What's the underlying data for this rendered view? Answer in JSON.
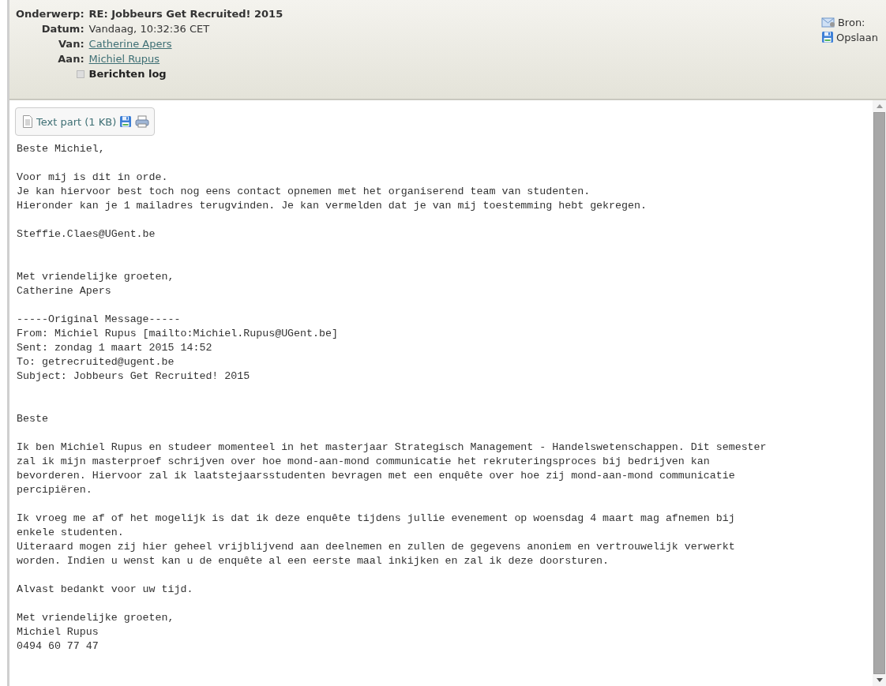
{
  "header": {
    "fields": [
      {
        "label": "Onderwerp:",
        "value": "RE: Jobbeurs Get Recruited! 2015",
        "kind": "subject"
      },
      {
        "label": "Datum:",
        "value": "Vandaag, 10:32:36 CET",
        "kind": "text"
      },
      {
        "label": "Van:",
        "value": "Catherine Apers",
        "kind": "link"
      },
      {
        "label": "Aan:",
        "value": "Michiel Rupus",
        "kind": "link"
      }
    ],
    "log": {
      "label": "Berichten log",
      "expanded": false
    },
    "actions": [
      {
        "label": "Bron:",
        "kind": "source"
      },
      {
        "label": "Opslaan",
        "kind": "save"
      }
    ]
  },
  "attachment": {
    "label": "Text part (1 KB)"
  },
  "body": "Beste Michiel,\n\nVoor mij is dit in orde.\nJe kan hiervoor best toch nog eens contact opnemen met het organiserend team van studenten.\nHieronder kan je 1 mailadres terugvinden. Je kan vermelden dat je van mij toestemming hebt gekregen.\n\nSteffie.Claes@UGent.be\n\n\nMet vriendelijke groeten,\nCatherine Apers\n\n-----Original Message-----\nFrom: Michiel Rupus [mailto:Michiel.Rupus@UGent.be]\nSent: zondag 1 maart 2015 14:52\nTo: getrecruited@ugent.be\nSubject: Jobbeurs Get Recruited! 2015\n\n\nBeste\n\nIk ben Michiel Rupus en studeer momenteel in het masterjaar Strategisch Management - Handelswetenschappen. Dit semester\nzal ik mijn masterproef schrijven over hoe mond-aan-mond communicatie het rekruteringsproces bij bedrijven kan\nbevorderen. Hiervoor zal ik laatstejaarsstudenten bevragen met een enquête over hoe zij mond-aan-mond communicatie\npercipiëren.\n\nIk vroeg me af of het mogelijk is dat ik deze enquête tijdens jullie evenement op woensdag 4 maart mag afnemen bij\nenkele studenten.\nUiteraard mogen zij hier geheel vrijblijvend aan deelnemen en zullen de gegevens anoniem en vertrouwelijk verwerkt\nworden. Indien u wenst kan u de enquête al een eerste maal inkijken en zal ik deze doorsturen.\n\nAlvast bedankt voor uw tijd.\n\nMet vriendelijke groeten,\nMichiel Rupus\n0494 60 77 47"
}
